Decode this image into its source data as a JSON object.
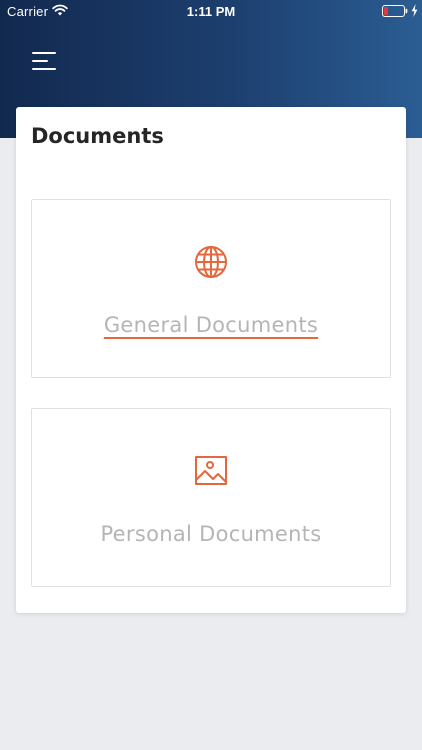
{
  "status_bar": {
    "carrier": "Carrier",
    "time": "1:11 PM",
    "icons": [
      "wifi-icon",
      "battery-low-icon",
      "charging-bolt-icon"
    ]
  },
  "header": {
    "menu_icon": "hamburger-menu-icon",
    "gradient_colors": [
      "#12294f",
      "#2b5d93"
    ]
  },
  "documents": {
    "title": "Documents",
    "items": [
      {
        "label": "General Documents",
        "icon": "globe-icon"
      },
      {
        "label": "Personal Documents",
        "icon": "image-icon"
      }
    ]
  },
  "colors": {
    "accent": "#e5673b",
    "label_gray": "#b5b5b5",
    "battery_low": "#e0393e",
    "background": "#ebecf0"
  }
}
